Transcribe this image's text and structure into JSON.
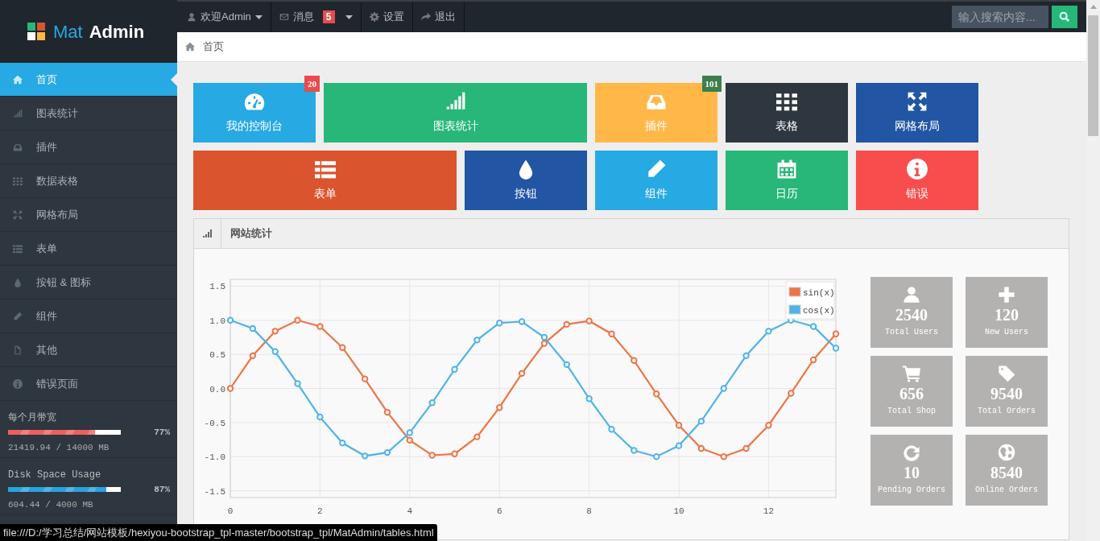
{
  "brand": {
    "part1": "Mat",
    "part2": "Admin"
  },
  "topnav": {
    "items": [
      {
        "label": "欢迎Admin",
        "caret": true
      },
      {
        "label": "消息",
        "badge": "5",
        "caret": true
      },
      {
        "label": "设置",
        "caret": false
      },
      {
        "label": "退出",
        "caret": false
      }
    ],
    "search": {
      "placeholder": "输入搜索内容..."
    }
  },
  "breadcrumb": "首页",
  "sidebar": {
    "items": [
      {
        "label": "首页",
        "selected": true
      },
      {
        "label": "图表统计",
        "selected": false
      },
      {
        "label": "插件",
        "selected": false
      },
      {
        "label": "数据表格",
        "selected": false
      },
      {
        "label": "网格布局",
        "selected": false
      },
      {
        "label": "表单",
        "selected": false
      },
      {
        "label": "按钮 & 图标",
        "selected": false
      },
      {
        "label": "组件",
        "selected": false
      },
      {
        "label": "其他",
        "selected": false
      },
      {
        "label": "错误页面",
        "selected": false
      }
    ],
    "meters": [
      {
        "label": "每个月带宽",
        "level": 0.77,
        "percent": "77%",
        "reading": "21419.94 / 14000 MB",
        "color": "#ef5f5f"
      },
      {
        "label": "Disk Space Usage",
        "level": 0.87,
        "percent": "87%",
        "reading": "604.44 / 4000 MB",
        "color": "#27a3e0"
      }
    ]
  },
  "tile_rows": [
    [
      {
        "label": "我的控制台",
        "kind": "narrow",
        "color": "#27a9e3",
        "badge": {
          "text": "20",
          "color": "#e84c4c"
        }
      },
      {
        "label": "图表统计",
        "kind": "wide",
        "color": "#28b779"
      },
      {
        "label": "插件",
        "kind": "narrow",
        "color": "#ffb848",
        "badge": {
          "text": "101",
          "color": "#3d7f4c"
        }
      },
      {
        "label": "表格",
        "kind": "narrow",
        "color": "#2e363f"
      },
      {
        "label": "网格布局",
        "kind": "narrow",
        "color": "#2255a4"
      }
    ],
    [
      {
        "label": "表单",
        "kind": "wide",
        "color": "#da542e"
      },
      {
        "label": "按钮",
        "kind": "narrow",
        "color": "#2255a4"
      },
      {
        "label": "组件",
        "kind": "narrow",
        "color": "#27a9e3"
      },
      {
        "label": "日历",
        "kind": "narrow",
        "color": "#28b779"
      },
      {
        "label": "错误",
        "kind": "narrow",
        "color": "#f74d4d"
      }
    ]
  ],
  "panel": {
    "title": "网站统计",
    "chart_data": {
      "type": "line",
      "x": [
        0,
        0.5,
        1,
        1.5,
        2,
        2.5,
        3,
        3.5,
        4,
        4.5,
        5,
        5.5,
        6,
        6.5,
        7,
        7.5,
        8,
        8.5,
        9,
        9.5,
        10,
        10.5,
        11,
        11.5,
        12,
        12.5,
        13,
        13.5
      ],
      "series": [
        {
          "name": "sin(x)",
          "color": "#ed7446",
          "marker": "circle",
          "values": [
            0,
            0.48,
            0.84,
            1.0,
            0.91,
            0.6,
            0.14,
            -0.35,
            -0.76,
            -0.98,
            -0.96,
            -0.71,
            -0.28,
            0.22,
            0.66,
            0.94,
            0.99,
            0.8,
            0.41,
            -0.08,
            -0.54,
            -0.88,
            -1.0,
            -0.88,
            -0.54,
            -0.07,
            0.42,
            0.8
          ]
        },
        {
          "name": "cos(x)",
          "color": "#4fb3e8",
          "marker": "circle",
          "values": [
            1.0,
            0.88,
            0.54,
            0.07,
            -0.42,
            -0.8,
            -0.99,
            -0.94,
            -0.65,
            -0.21,
            0.28,
            0.71,
            0.96,
            0.98,
            0.75,
            0.35,
            -0.15,
            -0.6,
            -0.91,
            -1.0,
            -0.84,
            -0.48,
            0.0,
            0.48,
            0.84,
            1.0,
            0.91,
            0.59
          ]
        }
      ],
      "grid": true,
      "legend": true,
      "xlim": [
        0,
        13.5
      ],
      "ylim": [
        -1.6,
        1.6
      ],
      "xticks": [
        {
          "value": 0,
          "label": "0"
        },
        {
          "value": 2,
          "label": "2"
        },
        {
          "value": 4,
          "label": "4"
        },
        {
          "value": 6,
          "label": "6"
        },
        {
          "value": 8,
          "label": "8"
        },
        {
          "value": 10,
          "label": "10"
        },
        {
          "value": 12,
          "label": "12"
        }
      ],
      "yticks": [
        {
          "value": 1.5,
          "label": "1.5"
        },
        {
          "value": 1,
          "label": "1.0"
        },
        {
          "value": 0.5,
          "label": "0.5"
        },
        {
          "value": 0,
          "label": "0.0"
        },
        {
          "value": -0.5,
          "label": "-0.5"
        },
        {
          "value": -1,
          "label": "-1.0"
        },
        {
          "value": -1.5,
          "label": "-1.5"
        }
      ]
    },
    "stats": [
      {
        "value": "2540",
        "label": "Total Users"
      },
      {
        "value": "120",
        "label": "New Users"
      },
      {
        "value": "656",
        "label": "Total Shop"
      },
      {
        "value": "9540",
        "label": "Total Orders"
      },
      {
        "value": "10",
        "label": "Pending Orders"
      },
      {
        "value": "8540",
        "label": "Online Orders"
      }
    ]
  },
  "status_url": "file:///D:/学习总结/网站模板/hexiyou-bootstrap_tpl-master/bootstrap_tpl/MatAdmin/tables.html"
}
